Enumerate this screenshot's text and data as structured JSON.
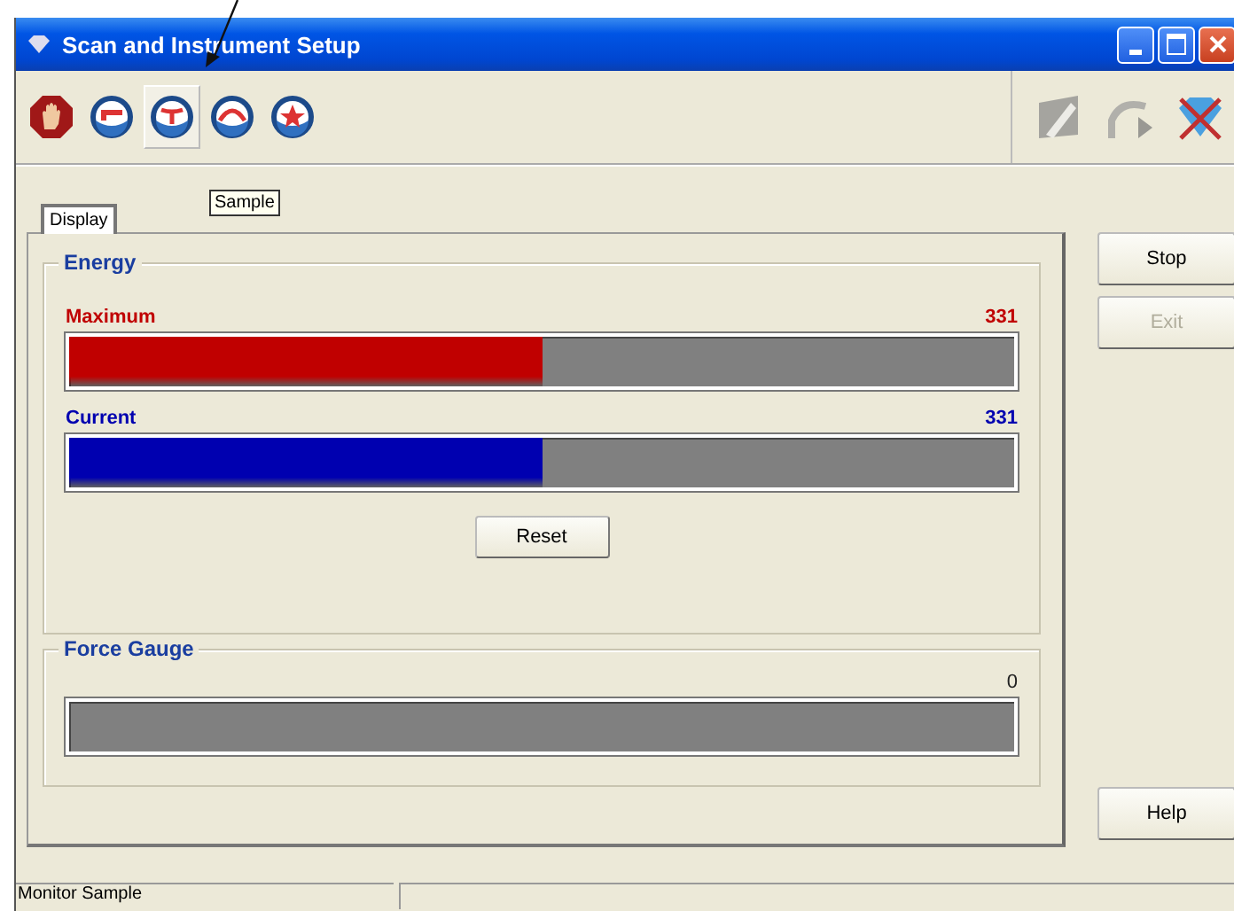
{
  "window": {
    "title": "Scan and Instrument Setup"
  },
  "toolbar": {
    "left_buttons": [
      {
        "kind": "stop",
        "selected": false
      },
      {
        "kind": "bars",
        "selected": false
      },
      {
        "kind": "split",
        "selected": true
      },
      {
        "kind": "arc",
        "selected": false
      },
      {
        "kind": "star",
        "selected": false
      }
    ],
    "right_buttons": [
      {
        "kind": "pen",
        "disabled": true
      },
      {
        "kind": "curve",
        "disabled": true
      },
      {
        "kind": "gem",
        "disabled": false
      }
    ]
  },
  "tooltip": "Sample",
  "tabs": [
    {
      "label": "Display",
      "selected": true
    }
  ],
  "energy": {
    "title": "Energy",
    "meters": [
      {
        "name": "Maximum",
        "reading": "331",
        "level": 0.5,
        "color": "#c00000"
      },
      {
        "name": "Current",
        "reading": "331",
        "level": 0.5,
        "color": "#0000b0"
      }
    ],
    "reset_button": "Reset"
  },
  "force_gauge": {
    "title": "Force Gauge",
    "reading": "0"
  },
  "side_buttons": [
    {
      "label": "Stop",
      "disabled": false
    },
    {
      "label": "Exit",
      "disabled": true
    },
    {
      "label": "Help",
      "disabled": false
    }
  ],
  "status_bar": "Monitor Sample"
}
